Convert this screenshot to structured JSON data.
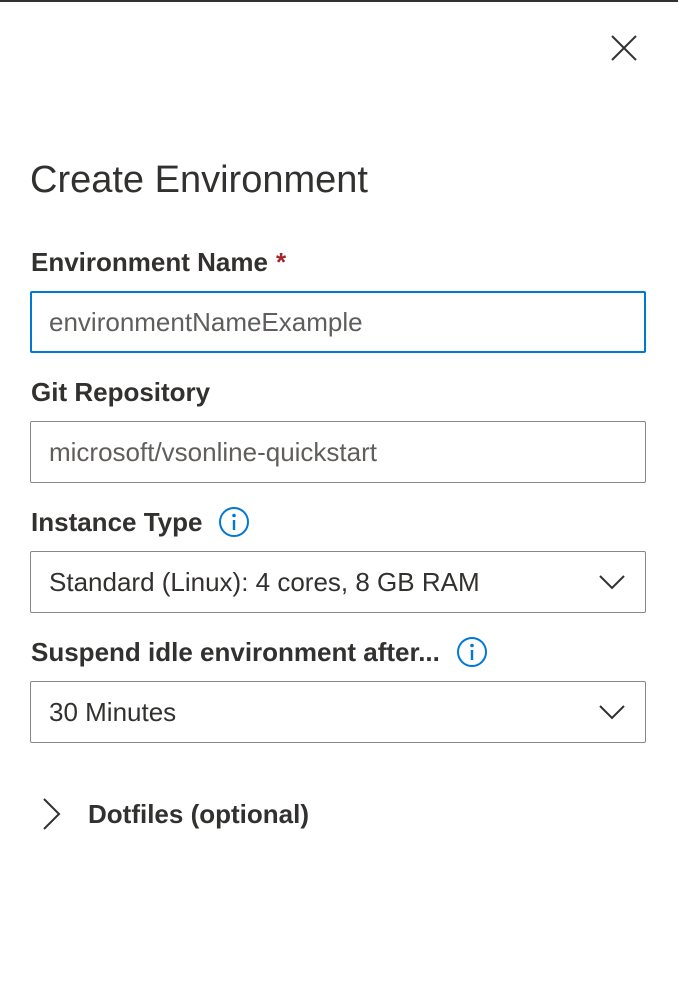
{
  "dialog": {
    "title": "Create Environment",
    "close_icon": "close-icon"
  },
  "form": {
    "name": {
      "label": "Environment Name",
      "required_mark": "*",
      "placeholder": "environmentNameExample",
      "value": ""
    },
    "repo": {
      "label": "Git Repository",
      "placeholder": "microsoft/vsonline-quickstart",
      "value": ""
    },
    "instance_type": {
      "label": "Instance Type",
      "info_icon": "info-icon",
      "selected": "Standard (Linux): 4 cores, 8 GB RAM"
    },
    "suspend": {
      "label": "Suspend idle environment after...",
      "info_icon": "info-icon",
      "selected": "30 Minutes"
    },
    "dotfiles": {
      "label": "Dotfiles (optional)",
      "icon": "chevron-right-icon"
    }
  },
  "colors": {
    "accent": "#0078d4",
    "required": "#a4262c",
    "text": "#323130",
    "border": "#8a8886"
  }
}
